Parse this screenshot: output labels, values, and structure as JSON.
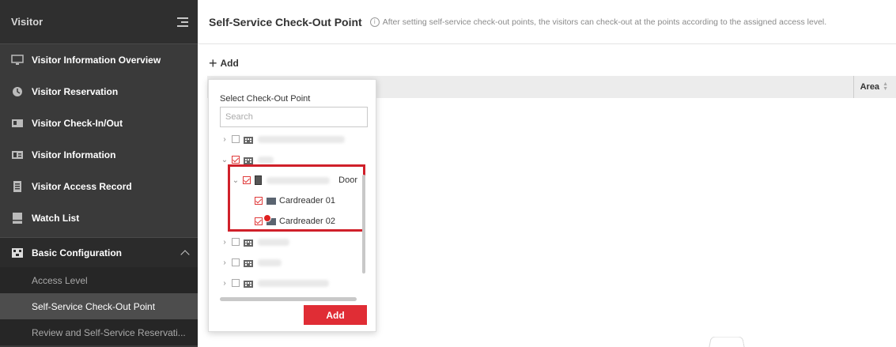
{
  "sidebar": {
    "title": "Visitor",
    "items": [
      {
        "label": "Visitor Information Overview",
        "icon": "monitor-icon"
      },
      {
        "label": "Visitor Reservation",
        "icon": "clock-icon"
      },
      {
        "label": "Visitor Check-In/Out",
        "icon": "id-card-icon"
      },
      {
        "label": "Visitor Information",
        "icon": "profile-card-icon"
      },
      {
        "label": "Visitor Access Record",
        "icon": "document-icon"
      },
      {
        "label": "Watch List",
        "icon": "list-icon"
      }
    ],
    "group": {
      "label": "Basic Configuration",
      "icon": "config-icon",
      "subitems": [
        {
          "label": "Access Level",
          "active": false
        },
        {
          "label": "Self-Service Check-Out Point",
          "active": true
        },
        {
          "label": "Review and Self-Service Reservati...",
          "active": false
        }
      ]
    }
  },
  "header": {
    "title": "Self-Service Check-Out Point",
    "info_icon": "i",
    "hint": "After setting self-service check-out points, the visitors can check-out at the points according to the assigned access level."
  },
  "toolbar": {
    "add_symbol": "+",
    "add_label": "Add"
  },
  "table": {
    "columns": [
      "Area"
    ]
  },
  "popup": {
    "title": "Select Check-Out Point",
    "search_placeholder": "Search",
    "tree": {
      "door_label": "Door",
      "readers": [
        "Cardreader 01",
        "Cardreader 02"
      ]
    },
    "add_button": "Add"
  },
  "colors": {
    "accent": "#e02d35",
    "sidebar_bg": "#3a3a3a",
    "highlight": "#d0202a"
  }
}
